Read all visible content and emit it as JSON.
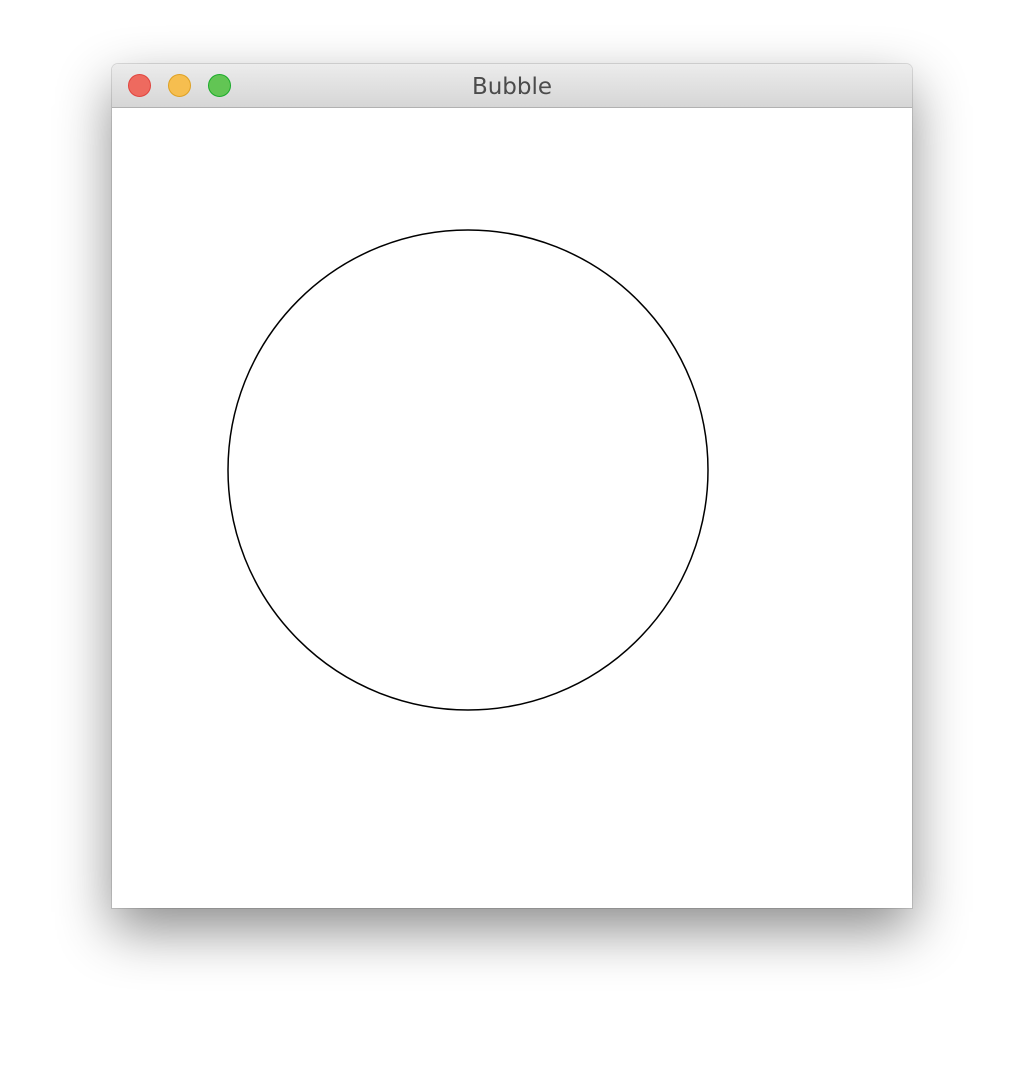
{
  "window": {
    "title": "Bubble",
    "buttons": {
      "close_color": "#ee6a5f",
      "minimize_color": "#f6be4f",
      "zoom_color": "#62c554"
    }
  },
  "canvas": {
    "background": "#ffffff",
    "shape": "circle",
    "stroke_color": "#000000"
  }
}
